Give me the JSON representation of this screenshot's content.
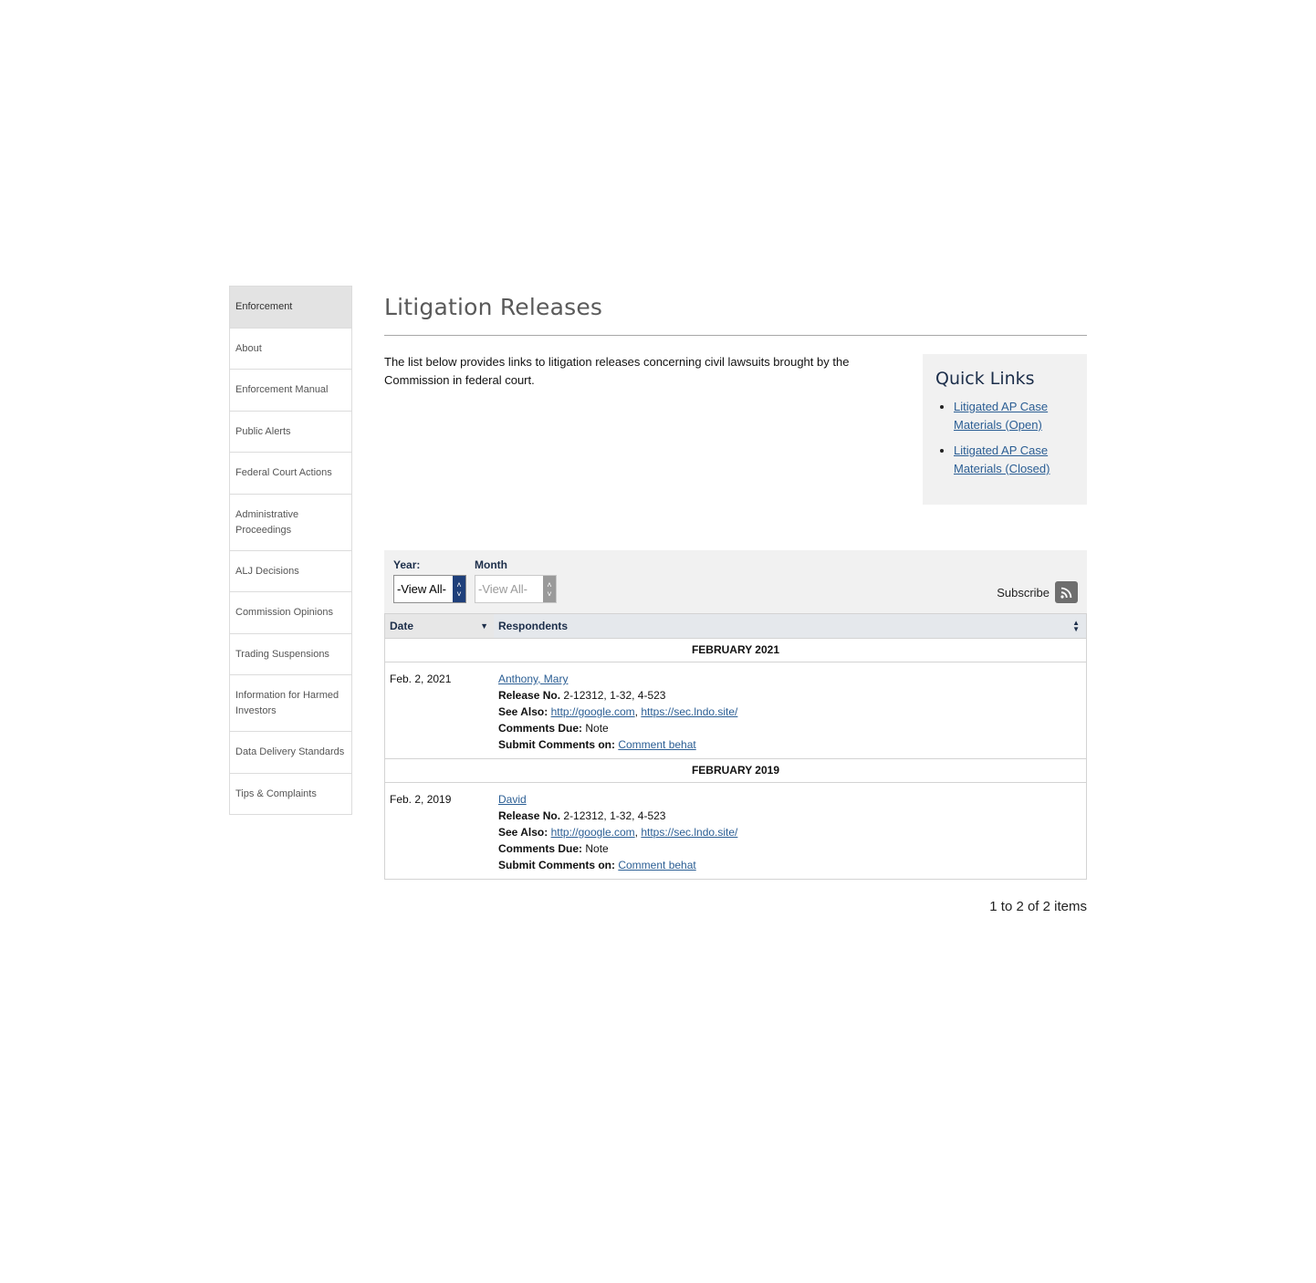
{
  "sidebar": {
    "items": [
      {
        "label": "Enforcement"
      },
      {
        "label": "About"
      },
      {
        "label": "Enforcement Manual"
      },
      {
        "label": "Public Alerts"
      },
      {
        "label": "Federal Court Actions"
      },
      {
        "label": "Administrative Proceedings"
      },
      {
        "label": "ALJ Decisions"
      },
      {
        "label": "Commission Opinions"
      },
      {
        "label": "Trading Suspensions"
      },
      {
        "label": "Information for Harmed Investors"
      },
      {
        "label": "Data Delivery Standards"
      },
      {
        "label": "Tips & Complaints"
      }
    ]
  },
  "page": {
    "title": "Litigation Releases",
    "intro": "The list below provides links to litigation releases concerning civil lawsuits brought by the Commission in federal court."
  },
  "quick_links": {
    "title": "Quick Links",
    "items": [
      {
        "label": "Litigated AP Case Materials (Open)"
      },
      {
        "label": "Litigated AP Case Materials (Closed)"
      }
    ]
  },
  "filter": {
    "year_label": "Year:",
    "year_value": "-View All-",
    "month_label": "Month",
    "month_value": "-View All-",
    "subscribe_label": "Subscribe"
  },
  "table": {
    "columns": {
      "date": "Date",
      "respondents": "Respondents"
    },
    "labels": {
      "release_no": "Release No.",
      "see_also": "See Also:",
      "comments_due": "Comments Due:",
      "submit_comments": "Submit Comments on:"
    },
    "groups": [
      {
        "heading": "FEBRUARY 2021",
        "rows": [
          {
            "date": "Feb. 2, 2021",
            "respondent": "Anthony, Mary",
            "release_no": "2-12312, 1-32, 4-523",
            "see_also_1": "http://google.com",
            "see_also_2": "https://sec.lndo.site/",
            "comments_due": "Note",
            "submit_link": "Comment behat"
          }
        ]
      },
      {
        "heading": "FEBRUARY 2019",
        "rows": [
          {
            "date": "Feb. 2, 2019",
            "respondent": "David",
            "release_no": "2-12312, 1-32, 4-523",
            "see_also_1": "http://google.com",
            "see_also_2": "https://sec.lndo.site/",
            "comments_due": "Note",
            "submit_link": "Comment behat"
          }
        ]
      }
    ]
  },
  "pager": {
    "summary": "1 to 2 of 2 items"
  },
  "colors": {
    "accent": "#1e3f7a",
    "heading": "#1c2e4a",
    "link": "#2b5e94"
  }
}
